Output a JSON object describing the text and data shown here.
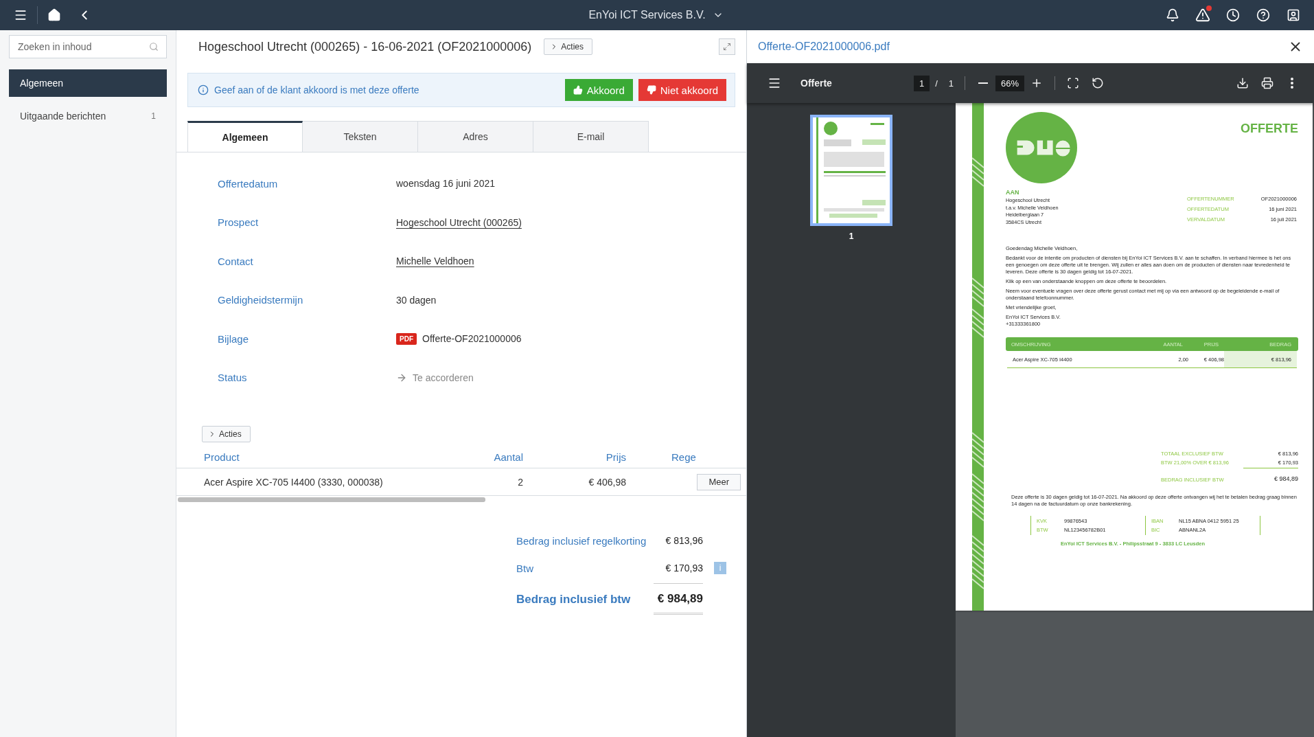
{
  "topbar": {
    "company": "EnYoi ICT Services B.V.",
    "warning_alert": true
  },
  "sidebar": {
    "search": {
      "placeholder": "Zoeken in inhoud"
    },
    "items": [
      {
        "label": "Algemeen",
        "selected": true
      },
      {
        "label": "Uitgaande berichten",
        "count": "1",
        "selected": false
      }
    ]
  },
  "record": {
    "title": "Hogeschool Utrecht (000265) - 16-06-2021 (OF2021000006)",
    "actions_label": "Acties",
    "banner": {
      "text": "Geef aan of de klant akkoord is met deze offerte",
      "accept": "Akkoord",
      "reject": "Niet akkoord"
    },
    "tabs": [
      {
        "label": "Algemeen",
        "selected": true
      },
      {
        "label": "Teksten",
        "selected": false
      },
      {
        "label": "Adres",
        "selected": false
      },
      {
        "label": "E-mail",
        "selected": false
      }
    ],
    "fields": [
      {
        "kind": "text",
        "label": "Offertedatum",
        "value": "woensdag 16 juni 2021"
      },
      {
        "kind": "link",
        "label": "Prospect",
        "value": "Hogeschool Utrecht (000265)"
      },
      {
        "kind": "link",
        "label": "Contact",
        "value": "Michelle Veldhoen"
      },
      {
        "kind": "text",
        "label": "Geldigheidstermijn",
        "value": "30 dagen"
      },
      {
        "kind": "file",
        "label": "Bijlage",
        "badge": "PDF",
        "value": "Offerte-OF2021000006"
      },
      {
        "kind": "status",
        "label": "Status",
        "value": "Te accorderen"
      }
    ],
    "lines_actions_label": "Acties",
    "lines": {
      "columns": [
        "Product",
        "Aantal",
        "Prijs",
        "Rege"
      ],
      "rows": [
        {
          "product": "Acer Aspire XC-705 I4400 (3330, 000038)",
          "aantal": "2",
          "prijs": "€ 406,98",
          "button": "Meer"
        }
      ]
    },
    "totals": [
      {
        "kind": "subtotal",
        "label": "Bedrag inclusief regelkorting",
        "value": "€ 813,96"
      },
      {
        "kind": "tax",
        "label": "Btw",
        "value": "€ 170,93",
        "info": "i"
      },
      {
        "kind": "grand",
        "label": "Bedrag inclusief btw",
        "value": "€ 984,89"
      }
    ]
  },
  "pdf": {
    "filename": "Offerte-OF2021000006.pdf",
    "toolbar": {
      "title": "Offerte",
      "page": "1",
      "separator": "/",
      "pages": "1",
      "zoom": "66%"
    },
    "thumbnails": [
      {
        "label": "1",
        "selected": true
      }
    ],
    "document": {
      "heading": "OFFERTE",
      "to_label": "AAN",
      "address": [
        "Hogeschool Utrecht",
        "t.a.v. Michelle Veldhoen",
        "Heidelberglaan 7",
        "3584CS Utrecht"
      ],
      "meta": [
        {
          "label": "OFFERTENUMMER",
          "value": "OF2021000006"
        },
        {
          "label": "OFFERTEDATUM",
          "value": "16 juni 2021"
        },
        {
          "label": "VERVALDATUM",
          "value": "16 juli 2021"
        }
      ],
      "letter": [
        "Goedendag Michelle Veldhoen,",
        "Bedankt voor de intentie om producten of diensten bij EnYoi ICT Services B.V. aan te schaffen. In verband hiermee is het ons een genoegen om deze offerte uit te brengen. Wij zullen er alles aan doen om de producten of diensten naar tevredenheid te leveren. Deze offerte is 30 dagen geldig tot 16-07-2021.",
        "Klik op een van onderstaande knoppen om deze offerte te beoordelen.",
        "Neem voor eventuele vragen over deze offerte gerust contact met mij op via een antwoord op de begeleidende e-mail of onderstaand telefoonnummer.",
        "Met vriendelijke groet,"
      ],
      "sender": [
        "EnYoi ICT Services B.V.",
        "+31333361800"
      ],
      "table": {
        "columns": [
          "OMSCHRIJVING",
          "AANTAL",
          "PRIJS",
          "BEDRAG"
        ],
        "rows": [
          [
            "Acer Aspire XC-705 I4400",
            "2,00",
            "€ 406,98",
            "€ 813,96"
          ]
        ]
      },
      "totals": [
        {
          "label": "TOTAAL EXCLUSIEF BTW",
          "value": "€ 813,96"
        },
        {
          "label": "BTW 21,00% OVER € 813,96",
          "value": "€ 170,93"
        }
      ],
      "grand": {
        "label": "BEDRAG INCLUSIEF BTW",
        "value": "€ 984,89"
      },
      "note": "Deze offerte is 30 dagen geldig tot 16-07-2021. Na akkoord op deze offerte ontvangen wij het te betalen bedrag graag binnen 14 dagen na de factuurdatum op onze bankrekening.",
      "registration": [
        [
          {
            "label": "KVK",
            "value": "99876543"
          },
          {
            "label": "BTW",
            "value": "NL123456782B01"
          }
        ],
        [
          {
            "label": "IBAN",
            "value": "NL15 ABNA 0412 5951 25"
          },
          {
            "label": "BIC",
            "value": "ABNANL2A"
          }
        ]
      ],
      "footer": "EnYoi ICT Services B.V. - Philipsstraat 9  - 3833 LC Leusden"
    }
  }
}
